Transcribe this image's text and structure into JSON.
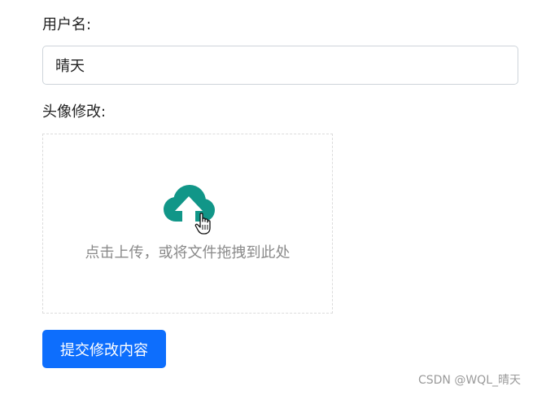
{
  "form": {
    "username_label": "用户名:",
    "username_value": "晴天",
    "avatar_label": "头像修改:",
    "upload_hint": "点击上传，或将文件拖拽到此处",
    "submit_label": "提交修改内容"
  },
  "icons": {
    "upload": "cloud-upload-icon",
    "cursor": "hand-pointer-icon"
  },
  "colors": {
    "primary": "#0d6efd",
    "upload_icon": "#119688",
    "hint_text": "#8a8a8a"
  },
  "watermark": "CSDN @WQL_晴天"
}
